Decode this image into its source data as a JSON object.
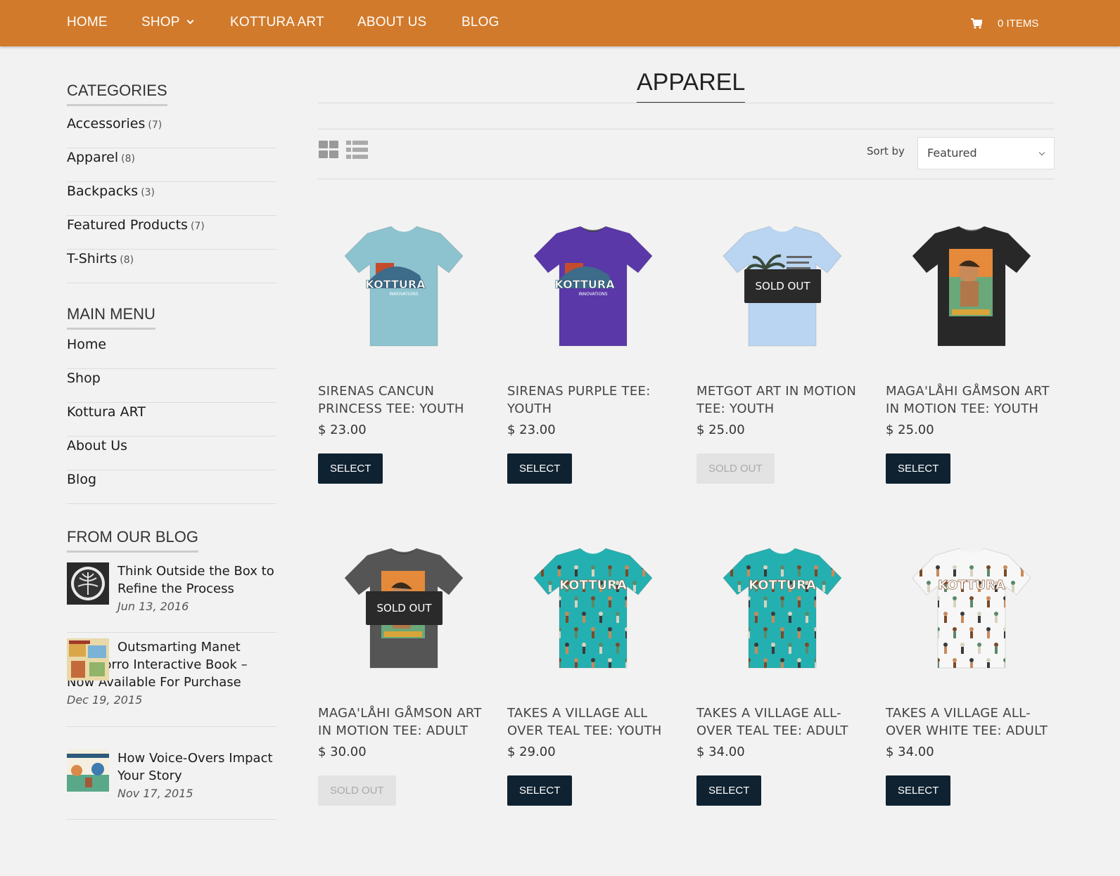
{
  "nav": {
    "items": [
      {
        "label": "HOME"
      },
      {
        "label": "SHOP"
      },
      {
        "label": "KOTTURA ART"
      },
      {
        "label": "ABOUT US"
      },
      {
        "label": "BLOG"
      }
    ],
    "cart_label": "0 ITEMS"
  },
  "sidebar": {
    "categories_title": "CATEGORIES",
    "categories": [
      {
        "label": "Accessories",
        "count": "(7)"
      },
      {
        "label": "Apparel",
        "count": "(8)"
      },
      {
        "label": "Backpacks",
        "count": "(3)"
      },
      {
        "label": "Featured Products",
        "count": "(7)"
      },
      {
        "label": "T-Shirts",
        "count": "(8)"
      }
    ],
    "menu_title": "MAIN MENU",
    "menu": [
      {
        "label": "Home"
      },
      {
        "label": "Shop"
      },
      {
        "label": "Kottura ART"
      },
      {
        "label": "About Us"
      },
      {
        "label": "Blog"
      }
    ],
    "blog_title": "FROM OUR BLOG",
    "posts": [
      {
        "title": "Think Outside the Box to Refine the Process",
        "date": "Jun 13, 2016"
      },
      {
        "title": "Outsmarting Manet Chamorro Interactive Book – Now Available For Purchase",
        "date": "Dec 19, 2015"
      },
      {
        "title": "How Voice-Overs Impact Your Story",
        "date": "Nov 17, 2015"
      }
    ]
  },
  "main": {
    "title": "APPAREL",
    "sort_label": "Sort by",
    "sort_value": "Featured",
    "products": [
      {
        "name": "SIRENAS CANCUN PRINCESS TEE: YOUTH",
        "price": "$ 23.00",
        "button": "SELECT",
        "sold_out": false,
        "shirt_color": "#8cc3cf",
        "graphic": "logo"
      },
      {
        "name": "SIRENAS PURPLE TEE: YOUTH",
        "price": "$ 23.00",
        "button": "SELECT",
        "sold_out": false,
        "shirt_color": "#5a38a8",
        "graphic": "logo"
      },
      {
        "name": "METGOT ART IN MOTION TEE: YOUTH",
        "price": "$ 25.00",
        "button": "SOLD OUT",
        "sold_out": true,
        "badge": "SOLD OUT",
        "shirt_color": "#b9d5f2",
        "graphic": "tree"
      },
      {
        "name": "MAGA'LÅHI GÅMSON ART IN MOTION TEE: YOUTH",
        "price": "$ 25.00",
        "button": "SELECT",
        "sold_out": false,
        "shirt_color": "#282828",
        "graphic": "poster"
      },
      {
        "name": "MAGA'LÅHI GÅMSON ART IN MOTION TEE: ADULT",
        "price": "$ 30.00",
        "button": "SOLD OUT",
        "sold_out": true,
        "badge": "SOLD OUT",
        "shirt_color": "#555555",
        "graphic": "poster"
      },
      {
        "name": "TAKES A VILLAGE ALL OVER TEAL TEE: YOUTH",
        "price": "$ 29.00",
        "button": "SELECT",
        "sold_out": false,
        "shirt_color": "#24b0b0",
        "graphic": "pattern"
      },
      {
        "name": "TAKES A VILLAGE ALL-OVER TEAL TEE: ADULT",
        "price": "$ 34.00",
        "button": "SELECT",
        "sold_out": false,
        "shirt_color": "#24b0b0",
        "graphic": "pattern"
      },
      {
        "name": "TAKES A VILLAGE ALL-OVER WHITE TEE: ADULT",
        "price": "$ 34.00",
        "button": "SELECT",
        "sold_out": false,
        "shirt_color": "#f7f7f7",
        "graphic": "pattern"
      }
    ]
  },
  "colors": {
    "nav_bg": "#d27a2b",
    "button_bg": "#0f2231",
    "page_bg": "#f2f2f2"
  }
}
